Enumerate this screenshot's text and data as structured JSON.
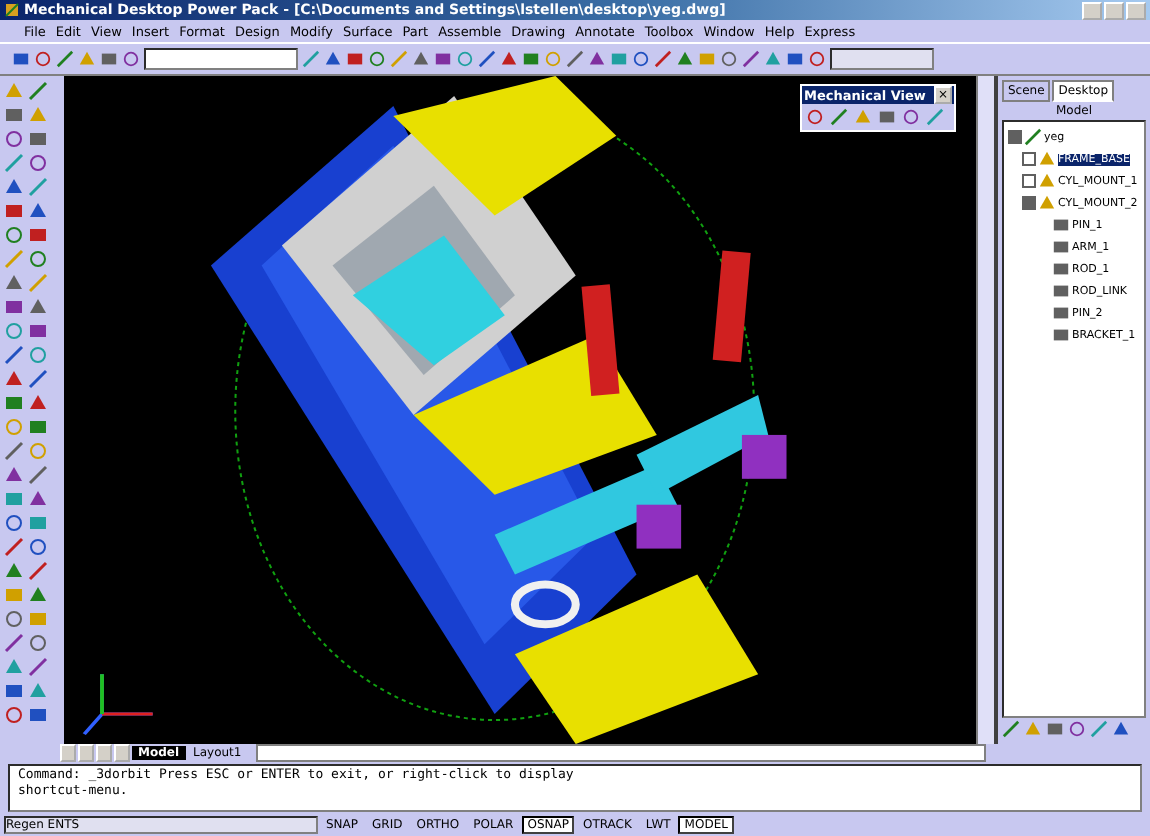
{
  "window": {
    "title": "Mechanical Desktop Power Pack - [C:\\Documents and Settings\\lstellen\\desktop\\yeg.dwg]"
  },
  "menu": [
    "File",
    "Edit",
    "View",
    "Insert",
    "Format",
    "Design",
    "Modify",
    "Surface",
    "Part",
    "Assemble",
    "Drawing",
    "Annotate",
    "Toolbox",
    "Window",
    "Help",
    "Express"
  ],
  "floating_toolbar": {
    "title": "Mechanical View",
    "close": "×"
  },
  "browser": {
    "tabs": [
      {
        "label": "Scene",
        "selected": false
      },
      {
        "label": "Desktop",
        "selected": true
      }
    ],
    "heading": "Model",
    "tree": [
      {
        "label": "yeg",
        "expanded": true,
        "selected": false,
        "children": [
          {
            "label": "FRAME_BASE",
            "expanded": false,
            "selected": true
          },
          {
            "label": "CYL_MOUNT_1",
            "expanded": false,
            "selected": false
          },
          {
            "label": "CYL_MOUNT_2",
            "expanded": true,
            "selected": false,
            "children": [
              {
                "label": "PIN_1",
                "selected": false
              },
              {
                "label": "ARM_1",
                "selected": false
              },
              {
                "label": "ROD_1",
                "selected": false
              },
              {
                "label": "ROD_LINK",
                "selected": false
              },
              {
                "label": "PIN_2",
                "selected": false
              },
              {
                "label": "BRACKET_1",
                "selected": false
              }
            ]
          }
        ]
      }
    ]
  },
  "layout_tabs": [
    {
      "label": "Model",
      "selected": true
    },
    {
      "label": "Layout1",
      "selected": false
    }
  ],
  "command": {
    "lines": [
      "Command:  _3dorbit Press ESC or ENTER to exit, or right-click to display",
      "shortcut-menu."
    ]
  },
  "status_bar": {
    "coordinates": "Regen ENTS",
    "buttons": [
      {
        "label": "SNAP",
        "on": false
      },
      {
        "label": "GRID",
        "on": false
      },
      {
        "label": "ORTHO",
        "on": false
      },
      {
        "label": "POLAR",
        "on": false
      },
      {
        "label": "OSNAP",
        "on": true
      },
      {
        "label": "OTRACK",
        "on": false
      },
      {
        "label": "LWT",
        "on": false
      },
      {
        "label": "MODEL",
        "on": true
      }
    ]
  }
}
